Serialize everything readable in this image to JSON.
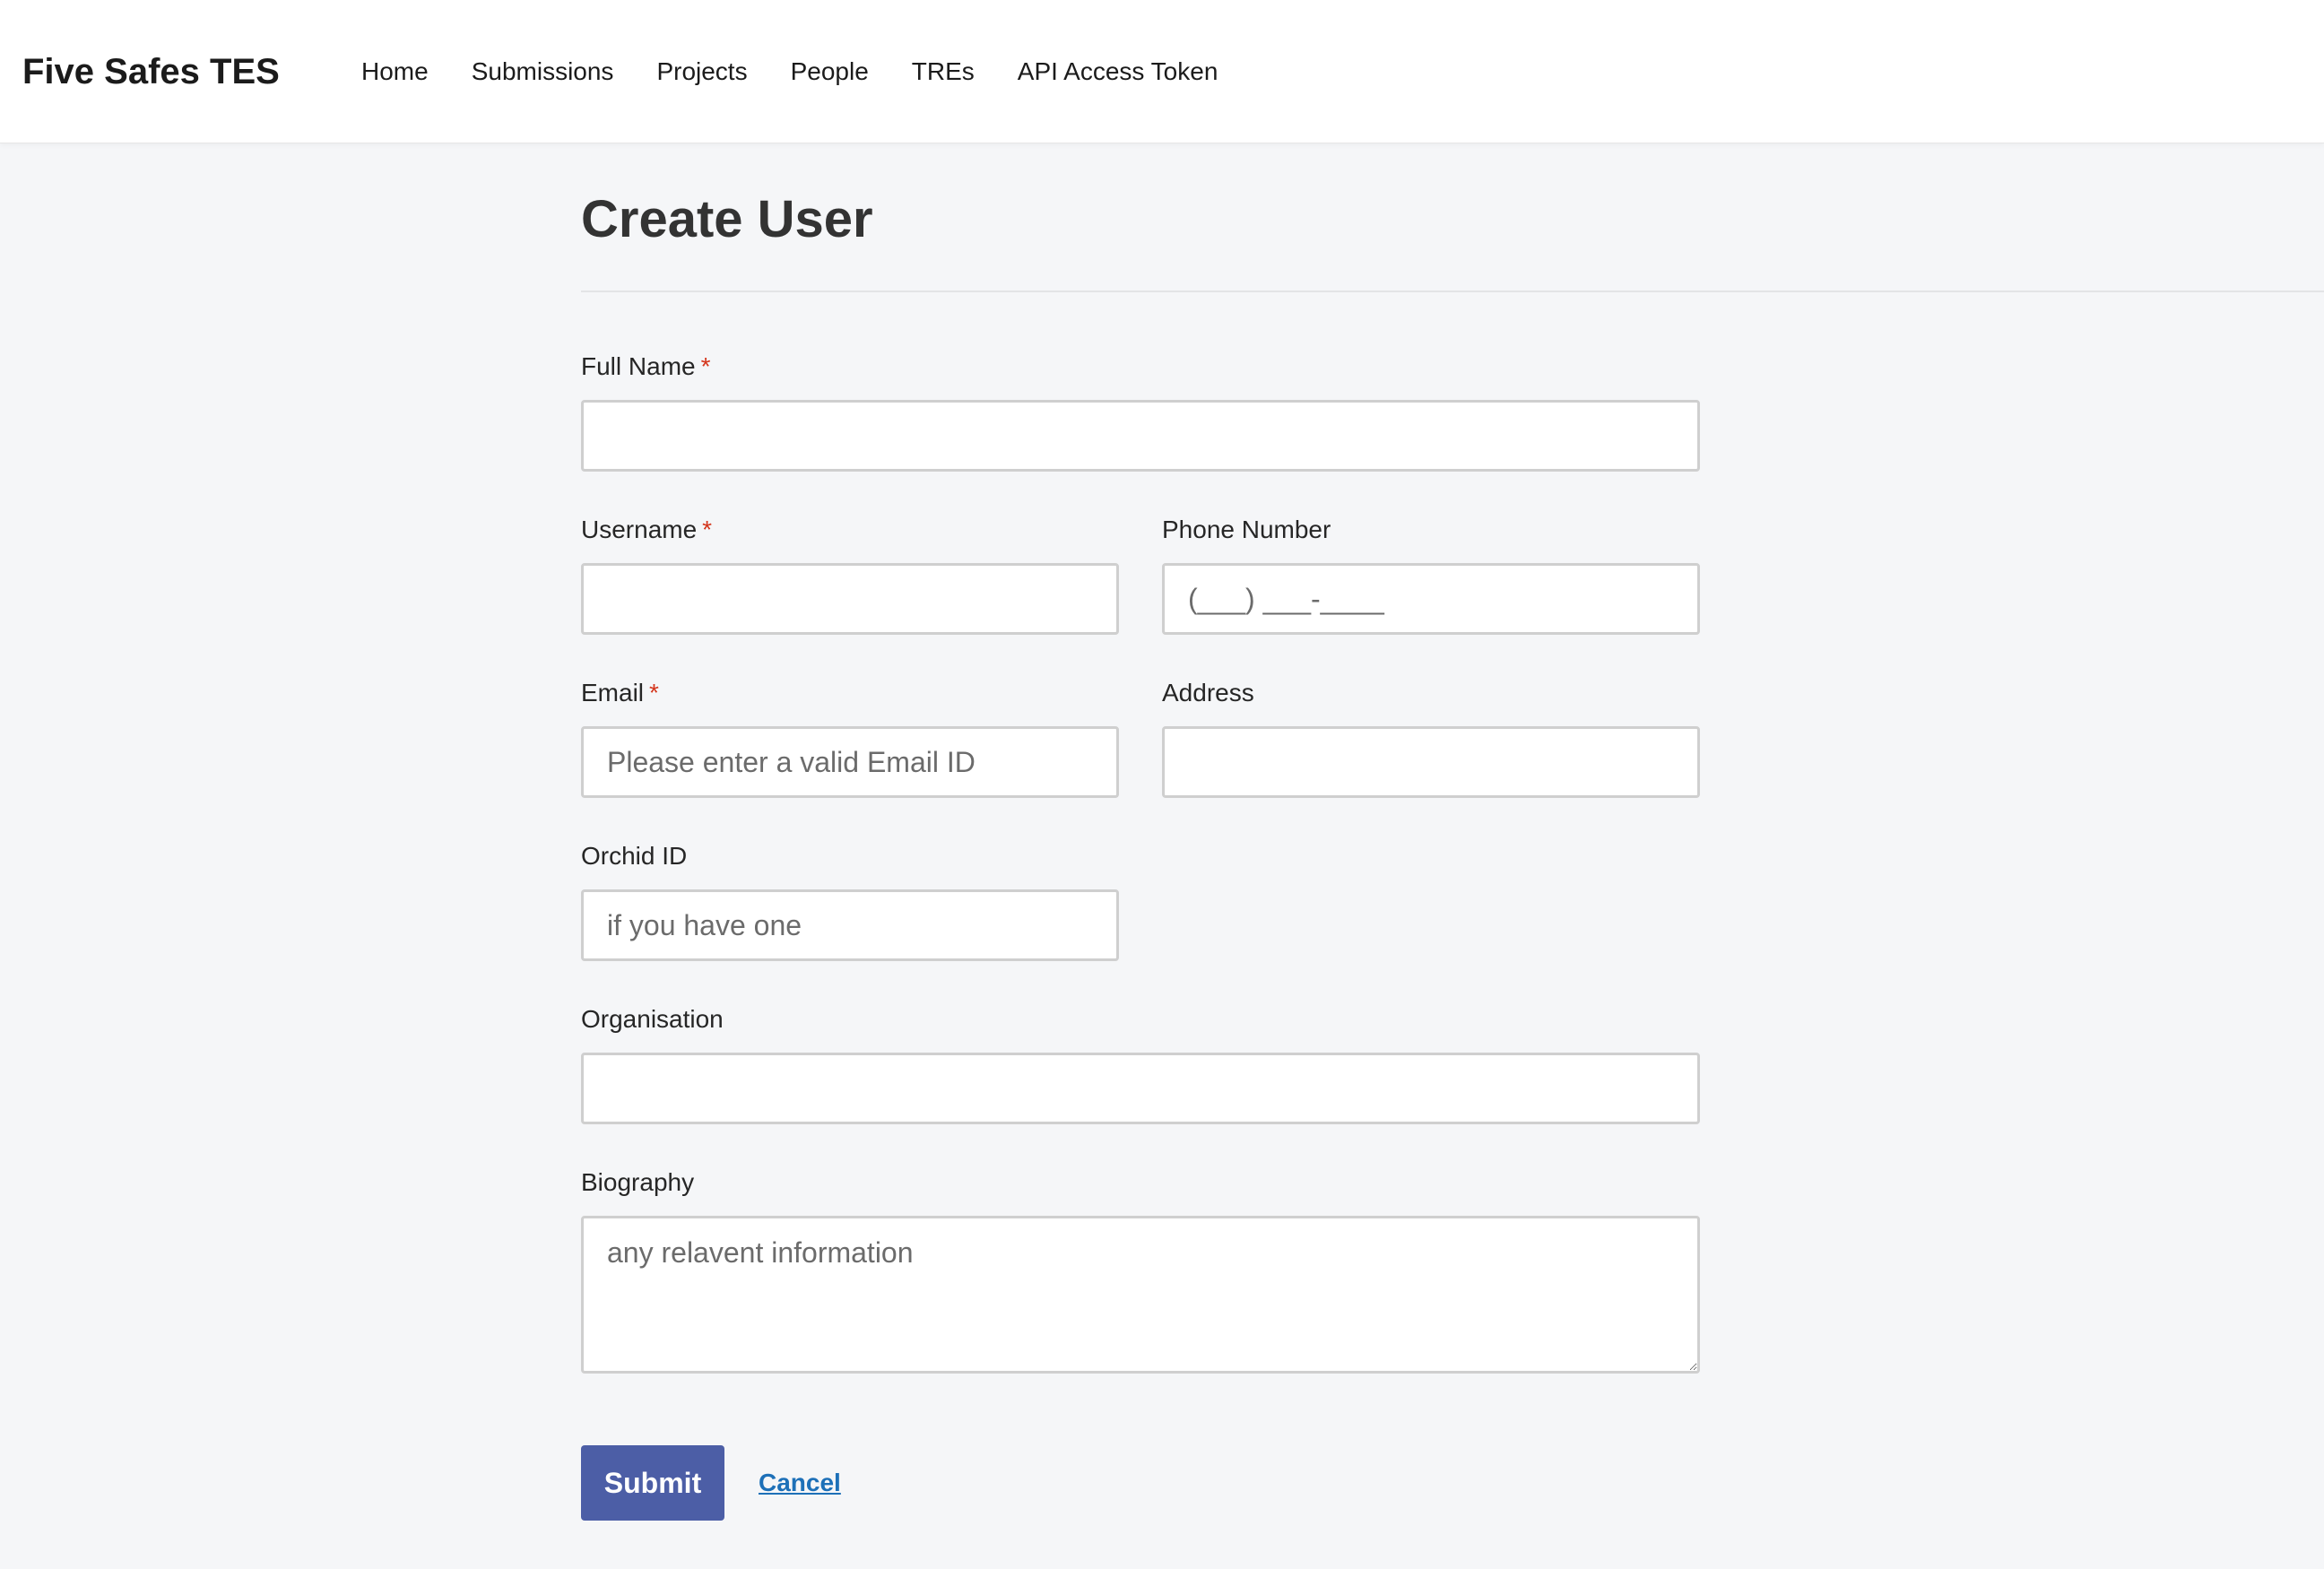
{
  "header": {
    "brand": "Five Safes TES",
    "nav": [
      {
        "label": "Home"
      },
      {
        "label": "Submissions"
      },
      {
        "label": "Projects"
      },
      {
        "label": "People"
      },
      {
        "label": "TREs"
      },
      {
        "label": "API Access Token"
      }
    ]
  },
  "page": {
    "title": "Create User"
  },
  "form": {
    "required_marker": "*",
    "full_name": {
      "label": "Full Name",
      "value": "",
      "placeholder": ""
    },
    "username": {
      "label": "Username",
      "value": "",
      "placeholder": ""
    },
    "phone": {
      "label": "Phone Number",
      "value": "",
      "placeholder": "(___) ___-____"
    },
    "email": {
      "label": "Email",
      "value": "",
      "placeholder": "Please enter a valid Email ID"
    },
    "address": {
      "label": "Address",
      "value": "",
      "placeholder": ""
    },
    "orchid": {
      "label": "Orchid ID",
      "value": "",
      "placeholder": "if you have one"
    },
    "organisation": {
      "label": "Organisation",
      "value": "",
      "placeholder": ""
    },
    "biography": {
      "label": "Biography",
      "value": "",
      "placeholder": "any relavent information"
    },
    "submit_label": "Submit",
    "cancel_label": "Cancel"
  },
  "colors": {
    "accent": "#4c5ea6",
    "link": "#1d70b8",
    "required": "#d4351c",
    "background": "#f5f6f8"
  }
}
